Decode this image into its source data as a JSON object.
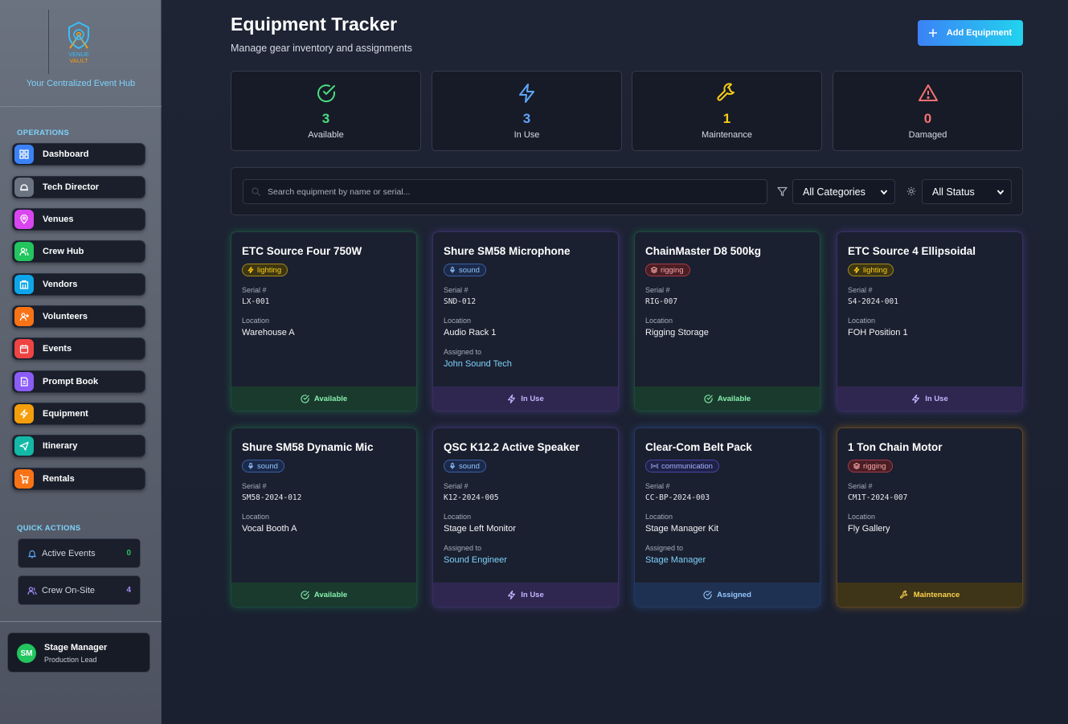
{
  "brand": {
    "logo_text": "VENUE VAULT",
    "tagline": "Your Centralized Event Hub"
  },
  "sidebar": {
    "operations_label": "OPERATIONS",
    "items": [
      {
        "label": "Dashboard",
        "icon": "grid-icon",
        "color": "#3b82f6"
      },
      {
        "label": "Tech Director",
        "icon": "hardhat-icon",
        "color": "#6b7280"
      },
      {
        "label": "Venues",
        "icon": "map-pin-icon",
        "color": "#d946ef"
      },
      {
        "label": "Crew Hub",
        "icon": "users-icon",
        "color": "#22c55e"
      },
      {
        "label": "Vendors",
        "icon": "building-icon",
        "color": "#0ea5e9"
      },
      {
        "label": "Volunteers",
        "icon": "user-plus-icon",
        "color": "#f97316"
      },
      {
        "label": "Events",
        "icon": "calendar-icon",
        "color": "#ef4444"
      },
      {
        "label": "Prompt Book",
        "icon": "book-icon",
        "color": "#8b5cf6"
      },
      {
        "label": "Equipment",
        "icon": "zap-icon",
        "color": "#f59e0b"
      },
      {
        "label": "Itinerary",
        "icon": "plane-icon",
        "color": "#14b8a6"
      },
      {
        "label": "Rentals",
        "icon": "cart-icon",
        "color": "#f97316"
      }
    ],
    "quick_actions_label": "QUICK ACTIONS",
    "quick_actions": [
      {
        "label": "Active Events",
        "count": "0",
        "icon": "bell-icon",
        "color": "#22c55e"
      },
      {
        "label": "Crew On-Site",
        "count": "4",
        "icon": "users-icon",
        "color": "#a78bfa"
      }
    ],
    "user": {
      "initials": "SM",
      "name": "Stage Manager",
      "role": "Production Lead"
    }
  },
  "header": {
    "title": "Equipment Tracker",
    "subtitle": "Manage gear inventory and assignments",
    "add_button": "Add Equipment"
  },
  "stats": [
    {
      "value": "3",
      "label": "Available",
      "icon": "check-circle-icon",
      "color": "#4ade80"
    },
    {
      "value": "3",
      "label": "In Use",
      "icon": "zap-icon",
      "color": "#60a5fa"
    },
    {
      "value": "1",
      "label": "Maintenance",
      "icon": "wrench-icon",
      "color": "#facc15"
    },
    {
      "value": "0",
      "label": "Damaged",
      "icon": "alert-triangle-icon",
      "color": "#f87171"
    }
  ],
  "filters": {
    "search_placeholder": "Search equipment by name or serial...",
    "category": "All Categories",
    "status": "All Status"
  },
  "labels": {
    "serial": "Serial #",
    "location": "Location",
    "assigned": "Assigned to"
  },
  "equipment": [
    {
      "name": "ETC Source Four 750W",
      "category": "lighting",
      "serial": "LX-001",
      "location": "Warehouse A",
      "assigned_to": "",
      "status": "Available"
    },
    {
      "name": "Shure SM58 Microphone",
      "category": "sound",
      "serial": "SND-012",
      "location": "Audio Rack 1",
      "assigned_to": "John Sound Tech",
      "status": "In Use"
    },
    {
      "name": "ChainMaster D8 500kg",
      "category": "rigging",
      "serial": "RIG-007",
      "location": "Rigging Storage",
      "assigned_to": "",
      "status": "Available"
    },
    {
      "name": "ETC Source 4 Ellipsoidal",
      "category": "lighting",
      "serial": "S4-2024-001",
      "location": "FOH Position 1",
      "assigned_to": "",
      "status": "In Use"
    },
    {
      "name": "Shure SM58 Dynamic Mic",
      "category": "sound",
      "serial": "SM58-2024-012",
      "location": "Vocal Booth A",
      "assigned_to": "",
      "status": "Available"
    },
    {
      "name": "QSC K12.2 Active Speaker",
      "category": "sound",
      "serial": "K12-2024-005",
      "location": "Stage Left Monitor",
      "assigned_to": "Sound Engineer",
      "status": "In Use"
    },
    {
      "name": "Clear-Com Belt Pack",
      "category": "communication",
      "serial": "CC-BP-2024-003",
      "location": "Stage Manager Kit",
      "assigned_to": "Stage Manager",
      "status": "Assigned"
    },
    {
      "name": "1 Ton Chain Motor",
      "category": "rigging",
      "serial": "CM1T-2024-007",
      "location": "Fly Gallery",
      "assigned_to": "",
      "status": "Maintenance"
    }
  ]
}
